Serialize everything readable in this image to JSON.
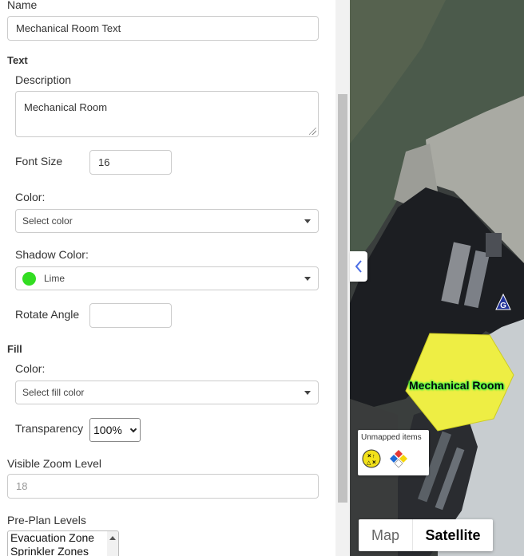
{
  "form": {
    "name_label": "Name",
    "name_value": "Mechanical Room Text",
    "text_section": "Text",
    "description_label": "Description",
    "description_value": "Mechanical Room",
    "font_size_label": "Font Size",
    "font_size_value": "16",
    "color_label": "Color:",
    "color_placeholder": "Select color",
    "shadow_color_label": "Shadow Color:",
    "shadow_color_value": "Lime",
    "shadow_color_hex": "#33dd22",
    "rotate_label": "Rotate Angle",
    "rotate_value": "",
    "fill_section": "Fill",
    "fill_color_label": "Color:",
    "fill_color_placeholder": "Select fill color",
    "transparency_label": "Transparency",
    "transparency_value": "100%",
    "zoom_label": "Visible Zoom Level",
    "zoom_value": "18",
    "preplan_label": "Pre-Plan Levels",
    "preplan_options": [
      "Evacuation Zone",
      "Sprinkler Zones"
    ]
  },
  "map": {
    "label_text": "Mechanical Room",
    "label_shadow_color": "#55ff55",
    "unmapped_title": "Unmapped items",
    "unmapped_icons": [
      "evacuation-zone-icon",
      "hazmat-diamond-icon"
    ],
    "type_map": "Map",
    "type_satellite": "Satellite",
    "active_type": "Satellite",
    "highlight_fill": "#eeee44",
    "pin_icon": "g-marker-icon"
  }
}
